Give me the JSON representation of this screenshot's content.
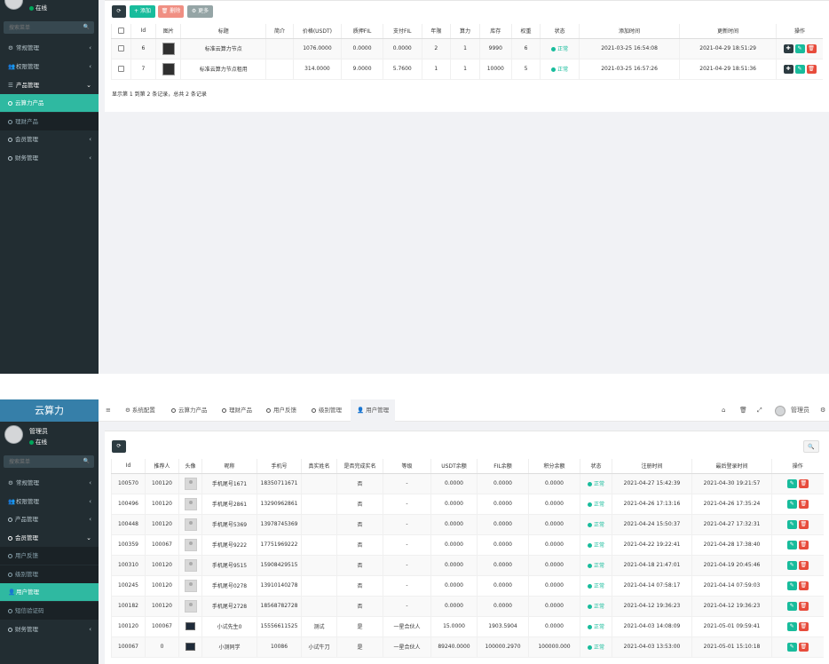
{
  "colors": {
    "sidebar_bg": "#222d32",
    "accent": "#2fb9a1",
    "logo_bg": "#367fa9",
    "status_green": "#18bc9c",
    "danger": "#e74c3c"
  },
  "screen1": {
    "user_status": "在线",
    "search_placeholder": "搜索菜单",
    "menu": [
      {
        "label": "常规管理",
        "icon": "gear-icon"
      },
      {
        "label": "权限管理",
        "icon": "users-icon"
      },
      {
        "label": "产品管理",
        "icon": "list-icon"
      },
      {
        "label": "云算力产品",
        "icon": "circle-icon"
      },
      {
        "label": "理财产品",
        "icon": "circle-icon"
      },
      {
        "label": "会员管理",
        "icon": "circle-icon"
      },
      {
        "label": "财务管理",
        "icon": "circle-icon"
      }
    ],
    "toolbar": {
      "refresh": "⟳",
      "add": "+ 添加",
      "delete": "🗑 删除",
      "more": "⚙ 更多"
    },
    "columns": [
      "",
      "Id",
      "图片",
      "标题",
      "简介",
      "价格(USDT)",
      "质押FIL",
      "支付FIL",
      "年限",
      "算力",
      "库存",
      "权重",
      "状态",
      "添加时间",
      "更新时间",
      "操作"
    ],
    "rows": [
      {
        "id": "6",
        "title": "标准云算力节点",
        "intro": "",
        "price": "1076.0000",
        "pledge": "0.0000",
        "pay": "0.0000",
        "years": "2",
        "power": "1",
        "stock": "9990",
        "weight": "6",
        "status": "正常",
        "added": "2021-03-25 16:54:08",
        "updated": "2021-04-29 18:51:29"
      },
      {
        "id": "7",
        "title": "标准云算力节点租用",
        "intro": "",
        "price": "314.0000",
        "pledge": "9.0000",
        "pay": "5.7600",
        "years": "1",
        "power": "1",
        "stock": "10000",
        "weight": "5",
        "status": "正常",
        "added": "2021-03-25 16:57:26",
        "updated": "2021-04-29 18:51:36"
      }
    ],
    "summary": "显示第 1 到第 2 条记录，总共 2 条记录"
  },
  "screen2": {
    "logo": "云算力",
    "user_name": "管理员",
    "user_status": "在线",
    "search_placeholder": "搜索菜单",
    "menu": [
      {
        "label": "常规管理"
      },
      {
        "label": "权限管理"
      },
      {
        "label": "产品管理"
      },
      {
        "label": "会员管理"
      },
      {
        "label": "用户反馈"
      },
      {
        "label": "级别管理"
      },
      {
        "label": "用户管理"
      },
      {
        "label": "短信验证码"
      },
      {
        "label": "财务管理"
      }
    ],
    "tabs": [
      {
        "label": "系统配置"
      },
      {
        "label": "云算力产品"
      },
      {
        "label": "理财产品"
      },
      {
        "label": "用户反馈"
      },
      {
        "label": "级别管理"
      },
      {
        "label": "用户管理"
      }
    ],
    "topbar_user": "管理员",
    "columns": [
      "Id",
      "推荐人",
      "头像",
      "昵称",
      "手机号",
      "真实姓名",
      "是否完成实名",
      "等级",
      "USDT余额",
      "FIL余额",
      "积分余额",
      "状态",
      "注册时间",
      "最后登录时间",
      "操作"
    ],
    "rows": [
      {
        "id": "100570",
        "ref": "100120",
        "nick": "手机尾号1671",
        "phone": "18350711671",
        "real": "",
        "verified": "否",
        "level": "-",
        "usdt": "0.0000",
        "fil": "0.0000",
        "points": "0.0000",
        "status": "正常",
        "reg": "2021-04-27 15:42:39",
        "last": "2021-04-30 19:21:57",
        "avatar": "default"
      },
      {
        "id": "100496",
        "ref": "100120",
        "nick": "手机尾号2861",
        "phone": "13290962861",
        "real": "",
        "verified": "否",
        "level": "-",
        "usdt": "0.0000",
        "fil": "0.0000",
        "points": "0.0000",
        "status": "正常",
        "reg": "2021-04-26 17:13:16",
        "last": "2021-04-26 17:35:24",
        "avatar": "default"
      },
      {
        "id": "100448",
        "ref": "100120",
        "nick": "手机尾号5369",
        "phone": "13978745369",
        "real": "",
        "verified": "否",
        "level": "-",
        "usdt": "0.0000",
        "fil": "0.0000",
        "points": "0.0000",
        "status": "正常",
        "reg": "2021-04-24 15:50:37",
        "last": "2021-04-27 17:32:31",
        "avatar": "default"
      },
      {
        "id": "100359",
        "ref": "100067",
        "nick": "手机尾号9222",
        "phone": "17751969222",
        "real": "",
        "verified": "否",
        "level": "-",
        "usdt": "0.0000",
        "fil": "0.0000",
        "points": "0.0000",
        "status": "正常",
        "reg": "2021-04-22 19:22:41",
        "last": "2021-04-28 17:38:40",
        "avatar": "default"
      },
      {
        "id": "100310",
        "ref": "100120",
        "nick": "手机尾号9515",
        "phone": "15908429515",
        "real": "",
        "verified": "否",
        "level": "-",
        "usdt": "0.0000",
        "fil": "0.0000",
        "points": "0.0000",
        "status": "正常",
        "reg": "2021-04-18 21:47:01",
        "last": "2021-04-19 20:45:46",
        "avatar": "default"
      },
      {
        "id": "100245",
        "ref": "100120",
        "nick": "手机尾号0278",
        "phone": "13910140278",
        "real": "",
        "verified": "否",
        "level": "-",
        "usdt": "0.0000",
        "fil": "0.0000",
        "points": "0.0000",
        "status": "正常",
        "reg": "2021-04-14 07:58:17",
        "last": "2021-04-14 07:59:03",
        "avatar": "default"
      },
      {
        "id": "100182",
        "ref": "100120",
        "nick": "手机尾号2728",
        "phone": "18568782728",
        "real": "",
        "verified": "否",
        "level": "-",
        "usdt": "0.0000",
        "fil": "0.0000",
        "points": "0.0000",
        "status": "正常",
        "reg": "2021-04-12 19:36:23",
        "last": "2021-04-12 19:36:23",
        "avatar": "default"
      },
      {
        "id": "100120",
        "ref": "100067",
        "nick": "小试先生0",
        "phone": "15556611525",
        "real": "测试",
        "verified": "是",
        "level": "一星合伙人",
        "usdt": "15.0000",
        "fil": "1903.5904",
        "points": "0.0000",
        "status": "正常",
        "reg": "2021-04-03 14:08:09",
        "last": "2021-05-01 09:59:41",
        "avatar": "pc"
      },
      {
        "id": "100067",
        "ref": "0",
        "nick": "小测同学",
        "phone": "10086",
        "real": "小试牛刀",
        "verified": "是",
        "level": "一星合伙人",
        "usdt": "89240.0000",
        "fil": "100000.2970",
        "points": "100000.000",
        "status": "正常",
        "reg": "2021-04-03 13:53:00",
        "last": "2021-05-01 15:10:18",
        "avatar": "pc"
      }
    ]
  }
}
